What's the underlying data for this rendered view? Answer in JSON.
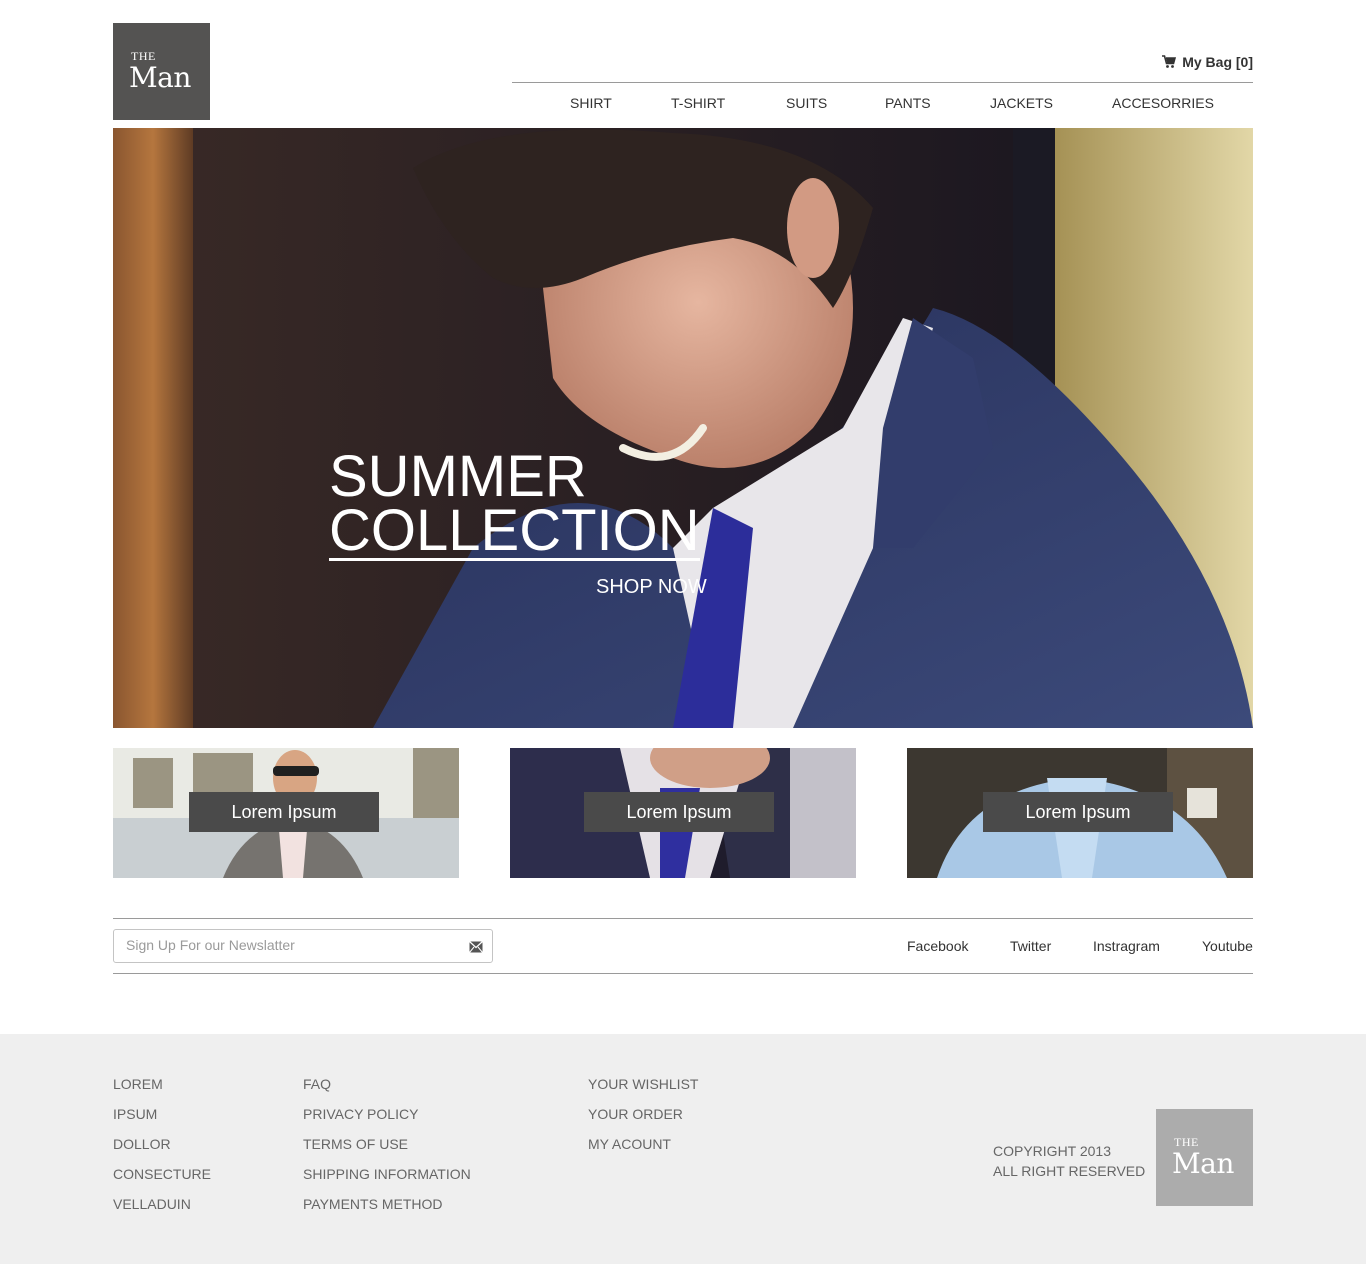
{
  "brand": {
    "logo_small": "THE",
    "logo_large": "Man"
  },
  "header": {
    "bag_label": "My Bag [0]",
    "nav": [
      {
        "label": "SHIRT"
      },
      {
        "label": "T-SHIRT"
      },
      {
        "label": "SUITS"
      },
      {
        "label": "PANTS"
      },
      {
        "label": "JACKETS"
      },
      {
        "label": "ACCESORRIES"
      }
    ]
  },
  "hero": {
    "title_line1": "SUMMER",
    "title_line2": "COLLECTION",
    "cta": "SHOP NOW"
  },
  "tiles": [
    {
      "label": "Lorem Ipsum"
    },
    {
      "label": "Lorem Ipsum"
    },
    {
      "label": "Lorem Ipsum"
    }
  ],
  "newsletter": {
    "placeholder": "Sign Up For our Newslatter"
  },
  "social": [
    {
      "label": "Facebook"
    },
    {
      "label": "Twitter"
    },
    {
      "label": "Instragram"
    },
    {
      "label": "Youtube"
    }
  ],
  "footer": {
    "col1": [
      "LOREM",
      "IPSUM",
      "DOLLOR",
      "CONSECTURE",
      "VELLADUIN"
    ],
    "col2": [
      "FAQ",
      "PRIVACY POLICY",
      "TERMS OF USE",
      "SHIPPING INFORMATION",
      "PAYMENTS METHOD"
    ],
    "col3": [
      "YOUR WISHLIST",
      "YOUR ORDER",
      "MY ACOUNT"
    ],
    "copyright_line1": "COPYRIGHT 2013",
    "copyright_line2": "ALL RIGHT RESERVED"
  },
  "colors": {
    "logo_dark": "#545352",
    "logo_light": "#acacac",
    "footer_bg": "#efefef",
    "button_bg": "#4a4a4a"
  }
}
